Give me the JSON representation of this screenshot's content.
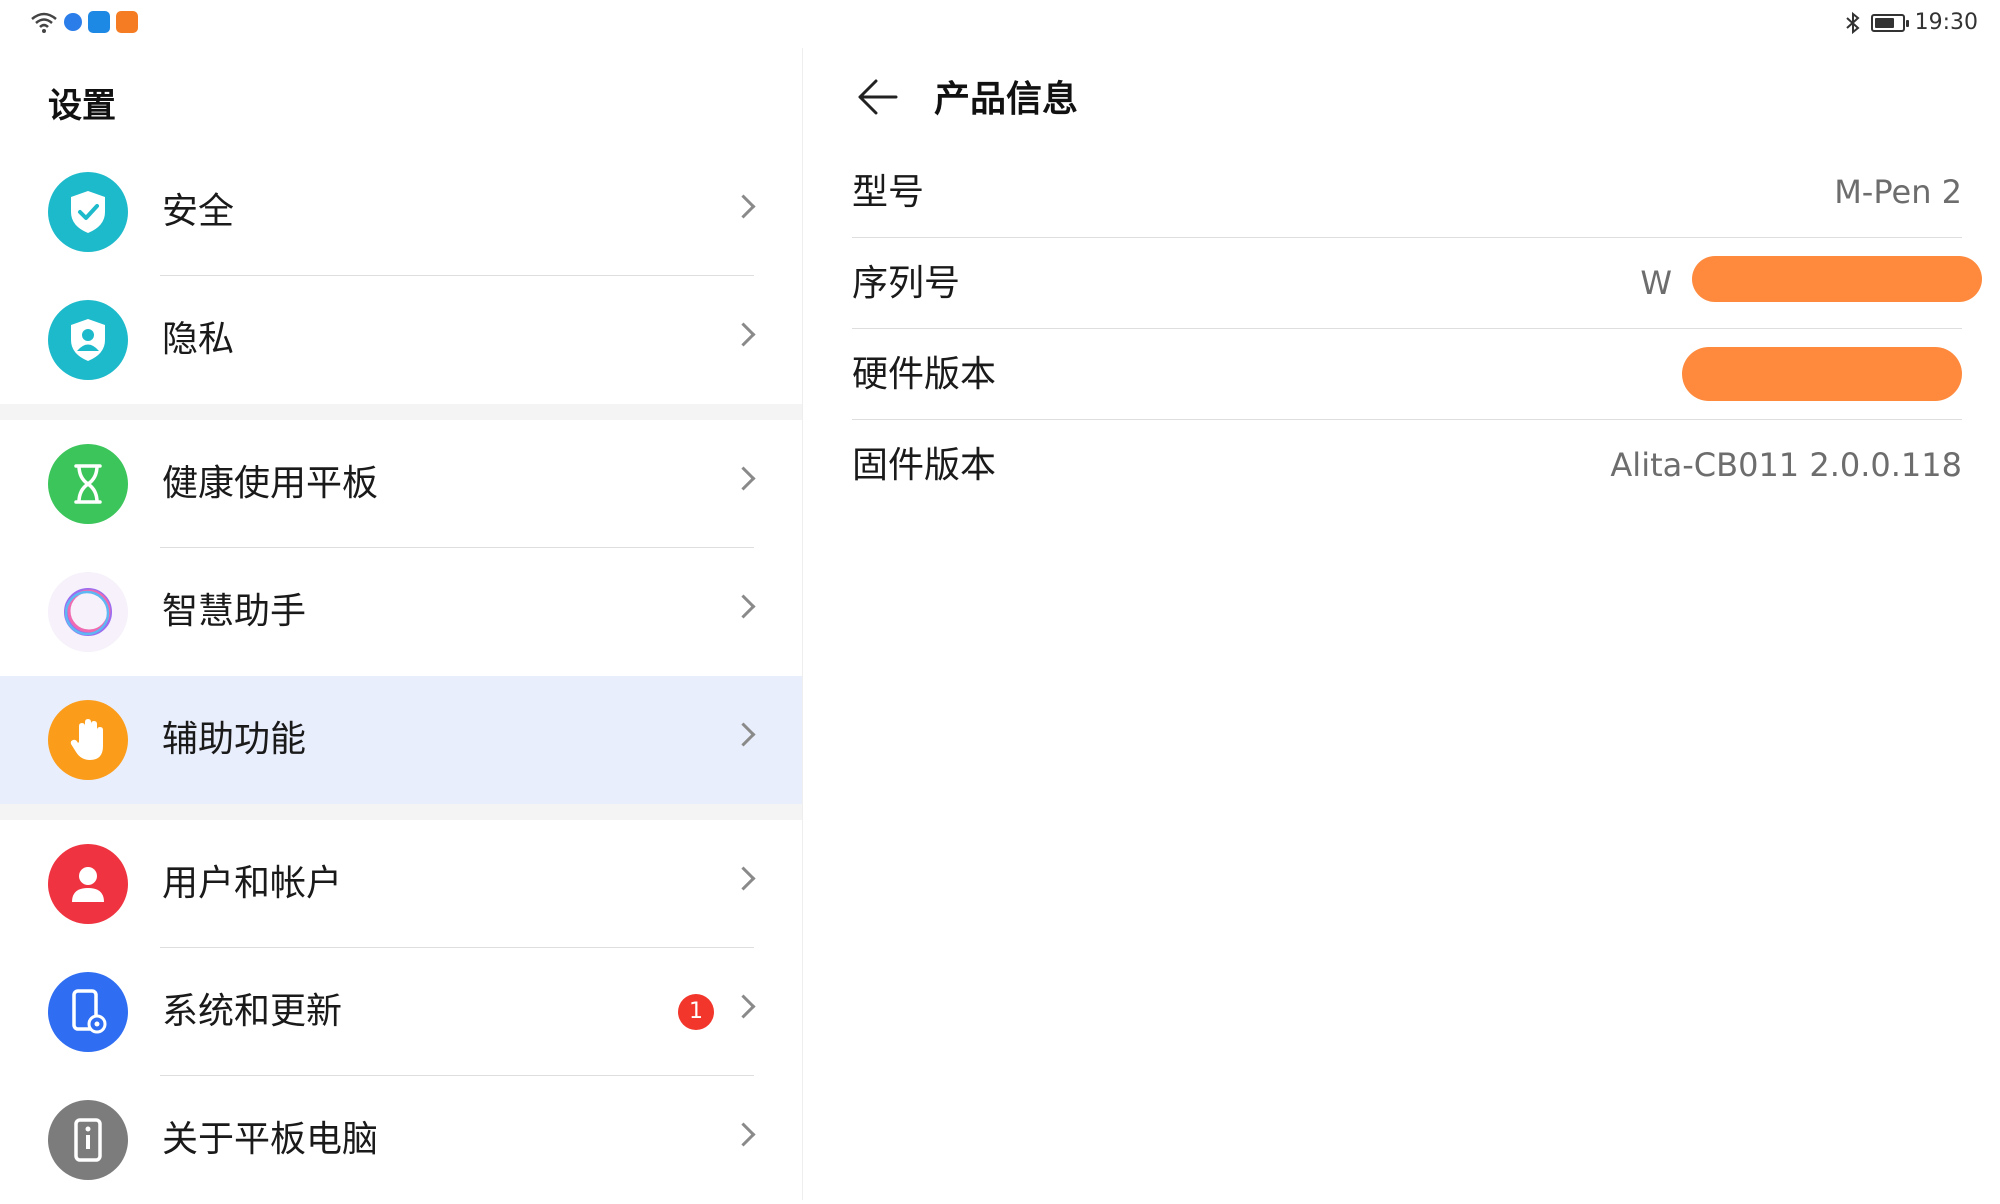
{
  "status_bar": {
    "time": "19:30",
    "battery_level": 0.75,
    "left_icons": [
      "wifi-icon",
      "browser-app-icon",
      "books-app-icon",
      "video-app-icon"
    ],
    "right_icons": [
      "bluetooth-icon",
      "battery-icon"
    ]
  },
  "settings": {
    "title": "设置",
    "items": [
      {
        "label": "安全",
        "icon": "shield-check-icon",
        "color": "#1dbacb"
      },
      {
        "label": "隐私",
        "icon": "privacy-shield-icon",
        "color": "#1dbacb"
      },
      {
        "label": "健康使用平板",
        "icon": "hourglass-icon",
        "color": "#3bc55a"
      },
      {
        "label": "智慧助手",
        "icon": "assistant-ring-icon",
        "color": "#f6f1fa"
      },
      {
        "label": "辅助功能",
        "icon": "hand-icon",
        "color": "#fb9c1a",
        "selected": true
      },
      {
        "label": "用户和帐户",
        "icon": "user-icon",
        "color": "#ef3340"
      },
      {
        "label": "系统和更新",
        "icon": "phone-gear-icon",
        "color": "#2f6ef2",
        "badge": "1"
      },
      {
        "label": "关于平板电脑",
        "icon": "tablet-info-icon",
        "color": "#7c7c7c"
      }
    ]
  },
  "product_info": {
    "title": "产品信息",
    "rows": [
      {
        "label": "型号",
        "value": "M-Pen 2"
      },
      {
        "label": "序列号",
        "value": "W"
      },
      {
        "label": "硬件版本",
        "value": ""
      },
      {
        "label": "固件版本",
        "value": "Alita-CB011 2.0.0.118"
      }
    ]
  },
  "colors": {
    "selected_bg": "#e9eefc",
    "badge": "#f2362b",
    "redaction": "#ff8a3d"
  }
}
